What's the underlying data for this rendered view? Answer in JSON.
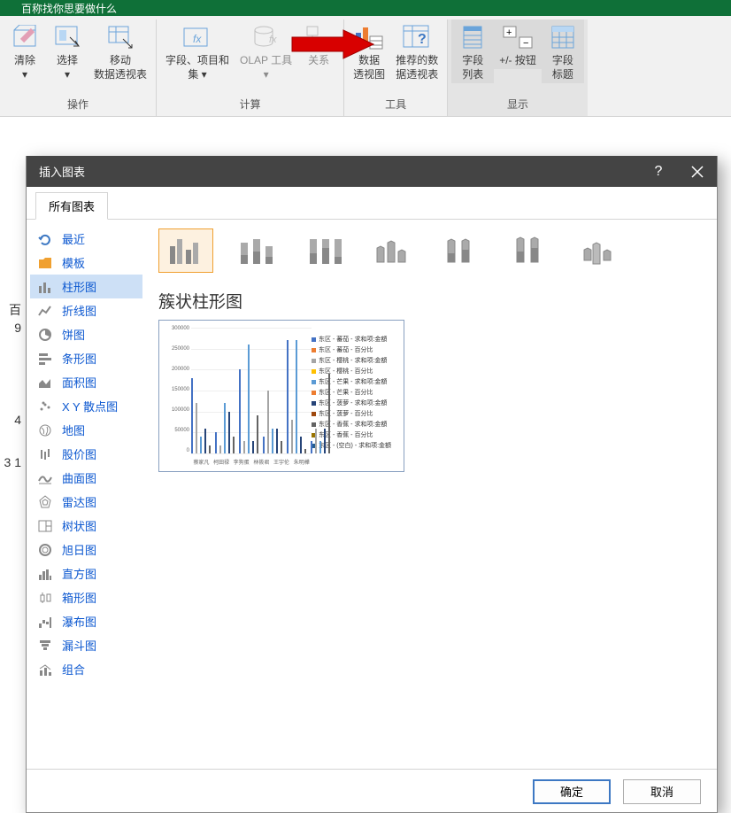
{
  "titlebar": {
    "text": "百称找你思要做什么"
  },
  "ribbon": {
    "groups": [
      {
        "label": "操作",
        "buttons": [
          {
            "key": "clear",
            "label": "清除\n▾"
          },
          {
            "key": "select",
            "label": "选择\n▾"
          },
          {
            "key": "move",
            "label": "移动\n数据透视表"
          }
        ]
      },
      {
        "label": "计算",
        "buttons": [
          {
            "key": "fields",
            "label": "字段、项目和\n集 ▾"
          },
          {
            "key": "olap",
            "label": "OLAP 工具\n▾"
          },
          {
            "key": "relation",
            "label": "关系"
          }
        ]
      },
      {
        "label": "工具",
        "buttons": [
          {
            "key": "pivotchart",
            "label": "数据\n透视图"
          },
          {
            "key": "recommend",
            "label": "推荐的数\n据透视表"
          }
        ]
      },
      {
        "label": "显示",
        "buttons": [
          {
            "key": "fieldlist",
            "label": "字段\n列表"
          },
          {
            "key": "plusminus",
            "label": "+/- 按钮"
          },
          {
            "key": "fieldheaders",
            "label": "字段\n标题"
          }
        ]
      }
    ]
  },
  "dialog": {
    "title": "插入图表",
    "tab": "所有图表",
    "categories": [
      {
        "key": "recent",
        "label": "最近"
      },
      {
        "key": "template",
        "label": "模板"
      },
      {
        "key": "column",
        "label": "柱形图",
        "selected": true
      },
      {
        "key": "line",
        "label": "折线图"
      },
      {
        "key": "pie",
        "label": "饼图"
      },
      {
        "key": "bar",
        "label": "条形图"
      },
      {
        "key": "area",
        "label": "面积图"
      },
      {
        "key": "xy",
        "label": "X Y 散点图"
      },
      {
        "key": "map",
        "label": "地图"
      },
      {
        "key": "stock",
        "label": "股价图"
      },
      {
        "key": "surface",
        "label": "曲面图"
      },
      {
        "key": "radar",
        "label": "雷达图"
      },
      {
        "key": "treemap",
        "label": "树状图"
      },
      {
        "key": "sunburst",
        "label": "旭日图"
      },
      {
        "key": "histogram",
        "label": "直方图"
      },
      {
        "key": "box",
        "label": "箱形图"
      },
      {
        "key": "waterfall",
        "label": "瀑布图"
      },
      {
        "key": "funnel",
        "label": "漏斗图"
      },
      {
        "key": "combo",
        "label": "组合"
      }
    ],
    "chart_title": "簇状柱形图",
    "ok": "确定",
    "cancel": "取消"
  },
  "chart_data": {
    "type": "bar",
    "title": "",
    "ylabel": "",
    "ylim": [
      0,
      300000
    ],
    "yticks": [
      0,
      50000,
      100000,
      150000,
      200000,
      250000,
      300000
    ],
    "categories": [
      "蔡家凡",
      "柯田禄",
      "李狗蛋",
      "林筱君",
      "王宇伦",
      "朱明樺"
    ],
    "series": [
      {
        "name": "东区 - 蕃茄 - 求和项:金額",
        "color": "#4472c4",
        "values": [
          180000,
          50000,
          200000,
          40000,
          270000,
          30000
        ]
      },
      {
        "name": "东区 - 蕃茄 - 百分比",
        "color": "#ed7d31",
        "values": [
          0,
          0,
          0,
          0,
          0,
          0
        ]
      },
      {
        "name": "东区 - 樱桃 - 求和项:金額",
        "color": "#a5a5a5",
        "values": [
          120000,
          20000,
          30000,
          150000,
          80000,
          60000
        ]
      },
      {
        "name": "东区 - 樱桃 - 百分比",
        "color": "#ffc000",
        "values": [
          0,
          0,
          0,
          0,
          0,
          0
        ]
      },
      {
        "name": "东区 - 芒果 - 求和项:金額",
        "color": "#5b9bd5",
        "values": [
          40000,
          120000,
          260000,
          60000,
          270000,
          30000
        ]
      },
      {
        "name": "东区 - 芒果 - 百分比",
        "color": "#ed7d31",
        "values": [
          0,
          0,
          0,
          0,
          0,
          0
        ]
      },
      {
        "name": "东区 - 菠萝 - 求和项:金額",
        "color": "#264478",
        "values": [
          60000,
          100000,
          30000,
          60000,
          40000,
          60000
        ]
      },
      {
        "name": "东区 - 菠萝 - 百分比",
        "color": "#9e480e",
        "values": [
          0,
          0,
          0,
          0,
          0,
          0
        ]
      },
      {
        "name": "东区 - 香蕉 - 求和项:金額",
        "color": "#636363",
        "values": [
          20000,
          40000,
          90000,
          30000,
          10000,
          190000
        ]
      },
      {
        "name": "东区 - 香蕉 - 百分比",
        "color": "#997300",
        "values": [
          0,
          0,
          0,
          0,
          0,
          0
        ]
      },
      {
        "name": "东区 - (空白) - 求和项:金額",
        "color": "#255e91",
        "values": [
          0,
          0,
          0,
          0,
          0,
          0
        ]
      }
    ]
  },
  "sheet_left": {
    "r1": "百",
    "r2": "9",
    "r3": "",
    "r4": "4",
    "r5": "",
    "r6": "3  1"
  }
}
